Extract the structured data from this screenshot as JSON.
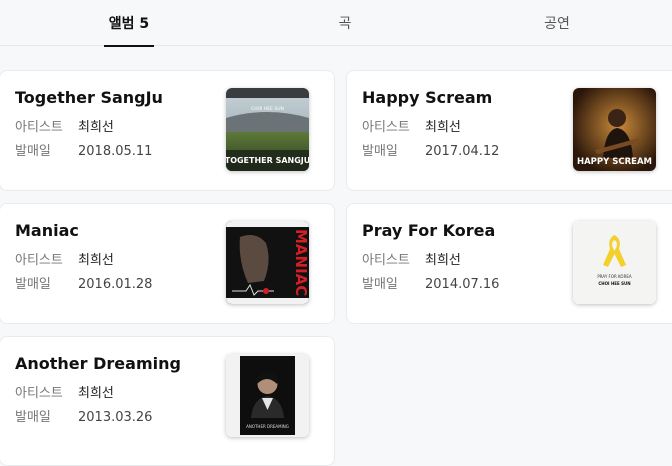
{
  "tabs": [
    {
      "label": "앨범 5",
      "active": true
    },
    {
      "label": "곡",
      "active": false
    },
    {
      "label": "공연",
      "active": false
    }
  ],
  "labels": {
    "artist": "아티스트",
    "release": "발매일"
  },
  "albums": [
    {
      "title": "Together SangJu",
      "artist": "최희선",
      "date": "2018.05.11",
      "cover": {
        "icon": "stadium-cover",
        "caption": "TOGETHER SANGJU",
        "top_text": "CHOI HEE SUN"
      }
    },
    {
      "title": "Happy Scream",
      "artist": "최희선",
      "date": "2017.04.12",
      "cover": {
        "icon": "guitarist-cover",
        "caption": "HAPPY SCREAM"
      }
    },
    {
      "title": "Maniac",
      "artist": "최희선",
      "date": "2016.01.28",
      "cover": {
        "icon": "hand-cover",
        "caption": "MANIAC"
      }
    },
    {
      "title": "Pray For Korea",
      "artist": "최희선",
      "date": "2014.07.16",
      "cover": {
        "icon": "yellow-ribbon-cover",
        "caption": "PRAY FOR KOREA",
        "sub": "CHOI HEE SUN"
      }
    },
    {
      "title": "Another Dreaming",
      "artist": "최희선",
      "date": "2013.03.26",
      "cover": {
        "icon": "portrait-cover",
        "caption": "ANOTHER DREAMING"
      }
    }
  ]
}
